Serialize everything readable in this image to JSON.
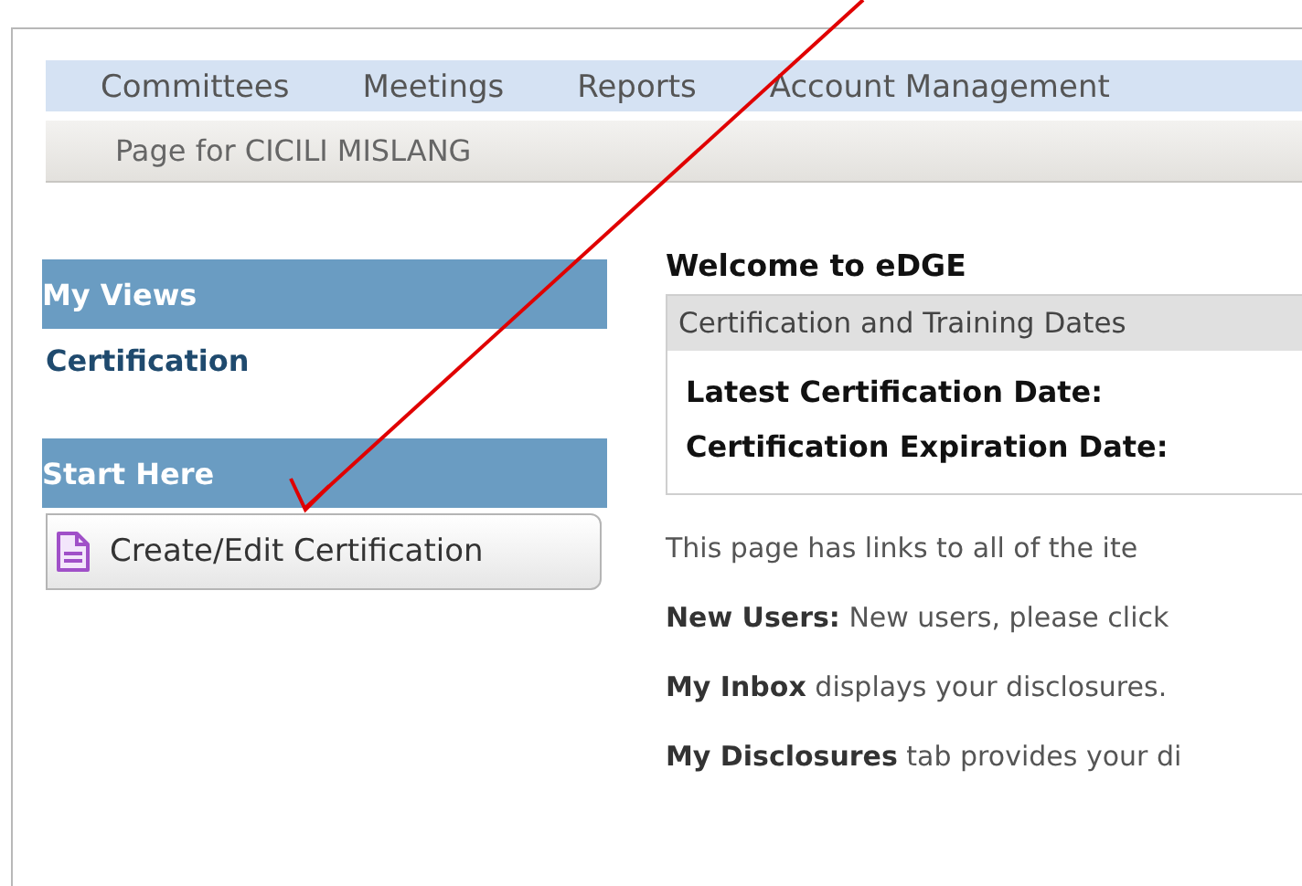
{
  "nav": {
    "items": [
      {
        "label": "Committees"
      },
      {
        "label": "Meetings"
      },
      {
        "label": "Reports"
      },
      {
        "label": "Account Management"
      }
    ]
  },
  "page_banner": "Page for CICILI MISLANG",
  "sidebar": {
    "sections": [
      {
        "title": "My Views",
        "items": [
          {
            "kind": "link",
            "label": "Certification"
          }
        ]
      },
      {
        "title": "Start Here",
        "items": [
          {
            "kind": "button",
            "label": "Create/Edit Certification"
          }
        ]
      }
    ]
  },
  "main": {
    "heading": "Welcome to eDGE",
    "dates_box": {
      "title": "Certification and Training Dates",
      "rows": [
        {
          "label": "Latest Certification Date:"
        },
        {
          "label": "Certification Expiration Date:"
        }
      ]
    },
    "paragraphs": [
      "This page has links to all of the ite",
      "**New Users:**  New users, please click",
      "**My Inbox** displays your disclosures.",
      "**My Disclosures** tab provides your di"
    ]
  }
}
